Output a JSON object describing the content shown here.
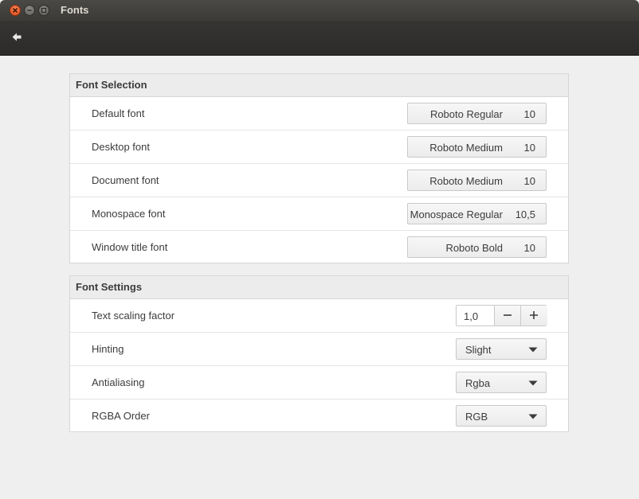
{
  "window": {
    "title": "Fonts"
  },
  "toolbar": {
    "back_icon": "back-arrow-icon"
  },
  "font_selection": {
    "header": "Font Selection",
    "rows": [
      {
        "label": "Default font",
        "font": "Roboto Regular",
        "size": "10"
      },
      {
        "label": "Desktop font",
        "font": "Roboto Medium",
        "size": "10"
      },
      {
        "label": "Document font",
        "font": "Roboto Medium",
        "size": "10"
      },
      {
        "label": "Monospace font",
        "font": "Monospace Regular",
        "size": "10,5"
      },
      {
        "label": "Window title font",
        "font": "Roboto Bold",
        "size": "10"
      }
    ]
  },
  "font_settings": {
    "header": "Font Settings",
    "text_scaling": {
      "label": "Text scaling factor",
      "value": "1,0"
    },
    "hinting": {
      "label": "Hinting",
      "value": "Slight"
    },
    "antialiasing": {
      "label": "Antialiasing",
      "value": "Rgba"
    },
    "rgba_order": {
      "label": "RGBA Order",
      "value": "RGB"
    }
  }
}
